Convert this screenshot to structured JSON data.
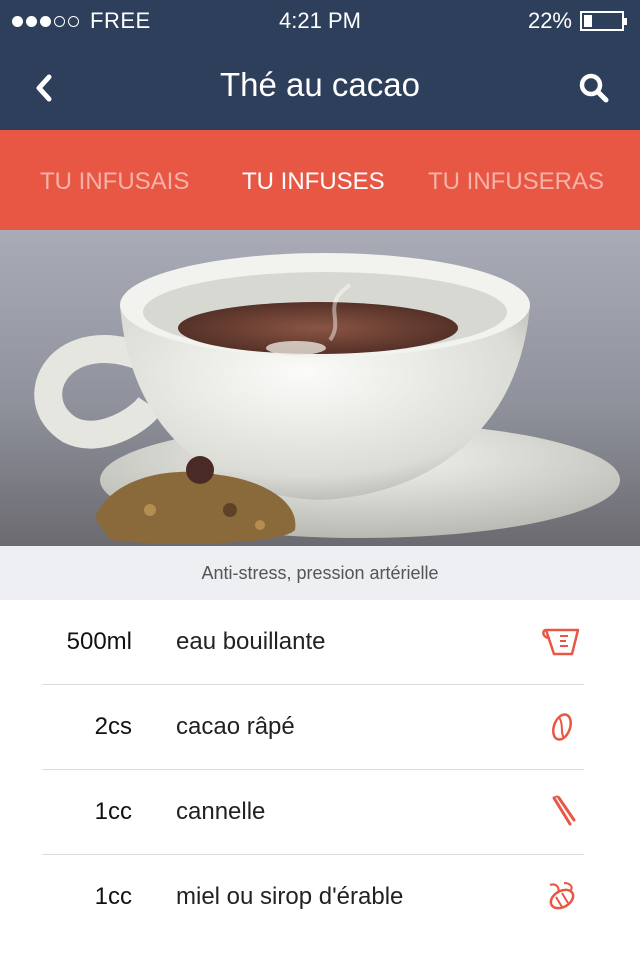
{
  "status_bar": {
    "signal_full": 3,
    "signal_empty": 2,
    "carrier": "FREE",
    "time": "4:21  PM",
    "battery_text": "22%",
    "battery_level": 0.22
  },
  "nav": {
    "title": "Thé au cacao",
    "back_icon": "chevron-left-icon",
    "search_icon": "search-icon"
  },
  "tabs": [
    {
      "label": "TU INFUSAIS",
      "active": false
    },
    {
      "label": "TU INFUSES",
      "active": true
    },
    {
      "label": "TU INFUSERAS",
      "active": false
    }
  ],
  "hero": {
    "caption": "Anti-stress, pression artérielle"
  },
  "ingredients": [
    {
      "qty": "500ml",
      "name": "eau bouillante",
      "icon": "measuring-cup-icon"
    },
    {
      "qty": "2cs",
      "name": "cacao râpé",
      "icon": "cocoa-bean-icon"
    },
    {
      "qty": "1cc",
      "name": "cannelle",
      "icon": "cinnamon-stick-icon"
    },
    {
      "qty": "1cc",
      "name": "miel ou sirop d'érable",
      "icon": "bee-icon"
    }
  ],
  "colors": {
    "header_bg": "#2e3f5c",
    "tab_bg": "#e85744",
    "accent": "#e85744"
  }
}
